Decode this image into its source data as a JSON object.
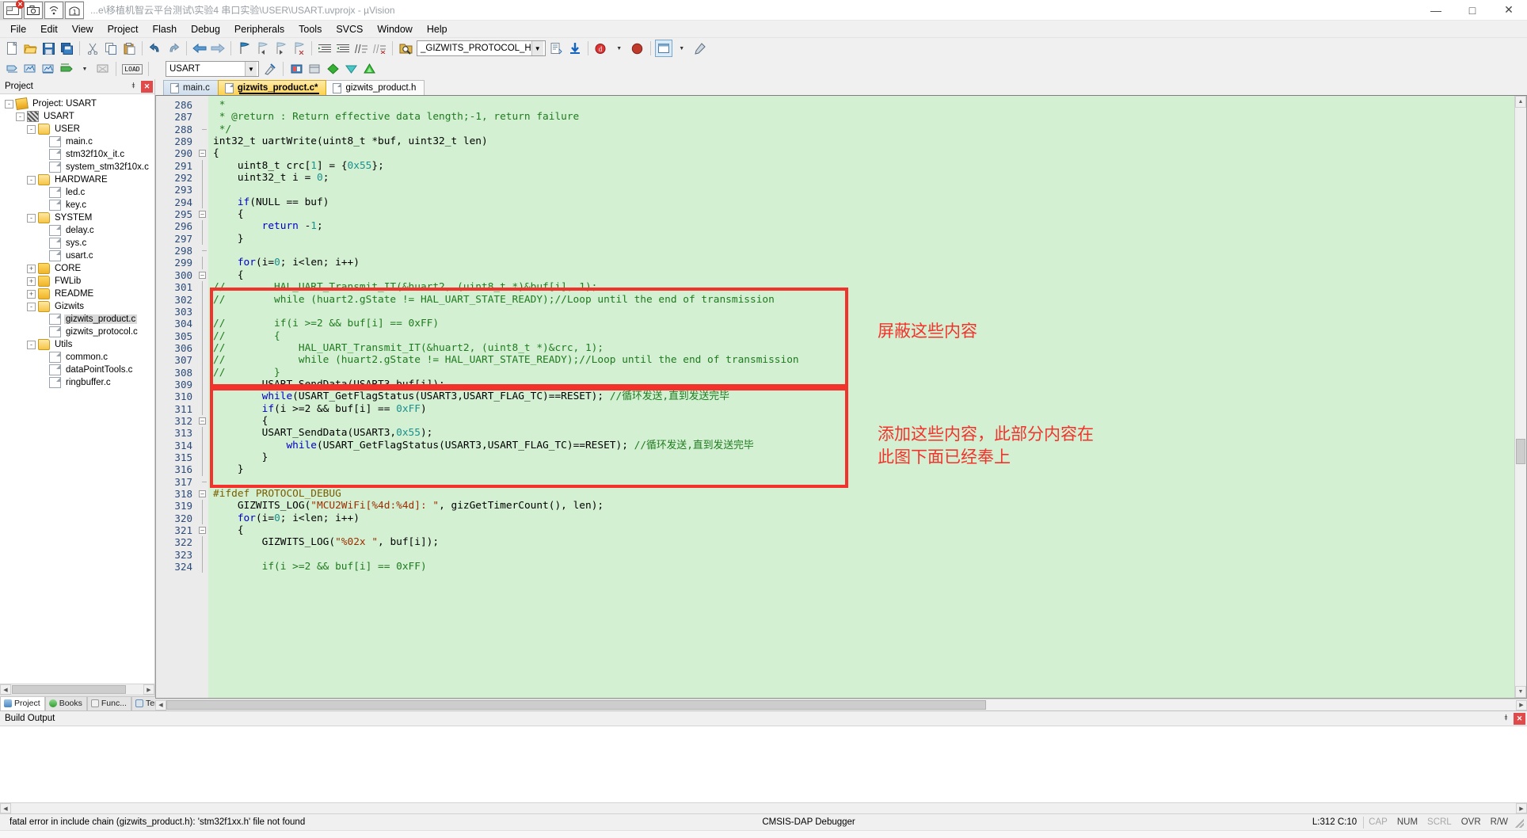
{
  "window": {
    "title": "...e\\移植机智云平台测试\\实验4 串口实验\\USER\\USART.uvprojx - µVision",
    "minimize": "—",
    "maximize": "□",
    "close": "✕"
  },
  "menubar": [
    "File",
    "Edit",
    "View",
    "Project",
    "Flash",
    "Debug",
    "Peripherals",
    "Tools",
    "SVCS",
    "Window",
    "Help"
  ],
  "toolbar1": {
    "buttons": [
      "new-file",
      "open-file",
      "save",
      "save-all",
      "cut",
      "copy",
      "paste",
      "undo",
      "redo",
      "navigate-back",
      "navigate-forward",
      "bookmark-toggle",
      "bookmark-prev",
      "bookmark-next",
      "bookmark-clear",
      "indent",
      "outdent",
      "comment",
      "uncomment",
      "find-in-files"
    ],
    "combo_value": "_GIZWITS_PROTOCOL_H",
    "extra": [
      "insert-file",
      "download",
      "debug-start",
      "debug-dropdown",
      "target-options"
    ]
  },
  "toolbar2": {
    "combo_value": "USART",
    "load_label": "LOAD",
    "buttons": [
      "translate",
      "build",
      "rebuild",
      "batch-build",
      "stop-build",
      "load-flash",
      "target-options-2",
      "manage-run-env",
      "new-item",
      "packs",
      "pack-installer"
    ]
  },
  "project_pane": {
    "title": "Project",
    "autohide_icon": "pin-icon",
    "close_icon": "close-icon",
    "tabs": [
      {
        "label": "Project",
        "icon": "project-icon",
        "active": true
      },
      {
        "label": "Books",
        "icon": "books-icon",
        "active": false
      },
      {
        "label": "Func...",
        "icon": "functions-icon",
        "active": false
      },
      {
        "label": "Temp...",
        "icon": "templates-icon",
        "active": false
      }
    ],
    "tree": [
      {
        "label": "Project: USART",
        "depth": 0,
        "icon": "project",
        "expander": "-"
      },
      {
        "label": "USART",
        "depth": 1,
        "icon": "target",
        "expander": "-"
      },
      {
        "label": "USER",
        "depth": 2,
        "icon": "folder-open",
        "expander": "-"
      },
      {
        "label": "main.c",
        "depth": 3,
        "icon": "file",
        "expander": ""
      },
      {
        "label": "stm32f10x_it.c",
        "depth": 3,
        "icon": "file",
        "expander": ""
      },
      {
        "label": "system_stm32f10x.c",
        "depth": 3,
        "icon": "file",
        "expander": ""
      },
      {
        "label": "HARDWARE",
        "depth": 2,
        "icon": "folder-open",
        "expander": "-"
      },
      {
        "label": "led.c",
        "depth": 3,
        "icon": "file",
        "expander": ""
      },
      {
        "label": "key.c",
        "depth": 3,
        "icon": "file",
        "expander": ""
      },
      {
        "label": "SYSTEM",
        "depth": 2,
        "icon": "folder-open",
        "expander": "-"
      },
      {
        "label": "delay.c",
        "depth": 3,
        "icon": "file",
        "expander": ""
      },
      {
        "label": "sys.c",
        "depth": 3,
        "icon": "file",
        "expander": ""
      },
      {
        "label": "usart.c",
        "depth": 3,
        "icon": "file",
        "expander": ""
      },
      {
        "label": "CORE",
        "depth": 2,
        "icon": "folder",
        "expander": "+"
      },
      {
        "label": "FWLib",
        "depth": 2,
        "icon": "folder",
        "expander": "+"
      },
      {
        "label": "README",
        "depth": 2,
        "icon": "folder",
        "expander": "+"
      },
      {
        "label": "Gizwits",
        "depth": 2,
        "icon": "folder-open",
        "expander": "-"
      },
      {
        "label": "gizwits_product.c",
        "depth": 3,
        "icon": "file",
        "expander": "",
        "selected": true
      },
      {
        "label": "gizwits_protocol.c",
        "depth": 3,
        "icon": "file",
        "expander": ""
      },
      {
        "label": "Utils",
        "depth": 2,
        "icon": "folder-open",
        "expander": "-"
      },
      {
        "label": "common.c",
        "depth": 3,
        "icon": "file",
        "expander": ""
      },
      {
        "label": "dataPointTools.c",
        "depth": 3,
        "icon": "file",
        "expander": ""
      },
      {
        "label": "ringbuffer.c",
        "depth": 3,
        "icon": "file",
        "expander": ""
      }
    ]
  },
  "editor": {
    "tabs": [
      {
        "label": "main.c",
        "state": "inactive"
      },
      {
        "label": "gizwits_product.c*",
        "state": "active"
      },
      {
        "label": "gizwits_product.h",
        "state": "plain"
      }
    ],
    "first_line_number": 286,
    "lines": [
      {
        "n": 286,
        "fold": "",
        "tokens": [
          {
            "t": " *",
            "c": "cm"
          }
        ]
      },
      {
        "n": 287,
        "fold": "",
        "tokens": [
          {
            "t": " * @return : Return effective data length;-1, return failure",
            "c": "cm"
          }
        ]
      },
      {
        "n": 288,
        "fold": "end",
        "tokens": [
          {
            "t": " */",
            "c": "cm"
          }
        ]
      },
      {
        "n": 289,
        "fold": "",
        "tokens": [
          {
            "t": "int32_t uartWrite(uint8_t *buf, uint32_t len)",
            "c": ""
          }
        ]
      },
      {
        "n": 290,
        "fold": "box",
        "tokens": [
          {
            "t": "{",
            "c": ""
          }
        ]
      },
      {
        "n": 291,
        "fold": "bar",
        "tokens": [
          {
            "t": "    uint8_t crc[",
            "c": ""
          },
          {
            "t": "1",
            "c": "num"
          },
          {
            "t": "] = {",
            "c": ""
          },
          {
            "t": "0x55",
            "c": "num"
          },
          {
            "t": "};",
            "c": ""
          }
        ]
      },
      {
        "n": 292,
        "fold": "bar",
        "tokens": [
          {
            "t": "    uint32_t i = ",
            "c": ""
          },
          {
            "t": "0",
            "c": "num"
          },
          {
            "t": ";",
            "c": ""
          }
        ]
      },
      {
        "n": 293,
        "fold": "bar",
        "tokens": [
          {
            "t": "",
            "c": ""
          }
        ]
      },
      {
        "n": 294,
        "fold": "bar",
        "tokens": [
          {
            "t": "    ",
            "c": ""
          },
          {
            "t": "if",
            "c": "k"
          },
          {
            "t": "(NULL == buf)",
            "c": ""
          }
        ]
      },
      {
        "n": 295,
        "fold": "box",
        "tokens": [
          {
            "t": "    {",
            "c": ""
          }
        ]
      },
      {
        "n": 296,
        "fold": "bar",
        "tokens": [
          {
            "t": "        ",
            "c": ""
          },
          {
            "t": "return",
            "c": "k"
          },
          {
            "t": " -",
            "c": ""
          },
          {
            "t": "1",
            "c": "num"
          },
          {
            "t": ";",
            "c": ""
          }
        ]
      },
      {
        "n": 297,
        "fold": "bar",
        "tokens": [
          {
            "t": "    }",
            "c": ""
          }
        ]
      },
      {
        "n": 298,
        "fold": "dash",
        "tokens": [
          {
            "t": "",
            "c": ""
          }
        ]
      },
      {
        "n": 299,
        "fold": "bar",
        "tokens": [
          {
            "t": "    ",
            "c": ""
          },
          {
            "t": "for",
            "c": "k"
          },
          {
            "t": "(i=",
            "c": ""
          },
          {
            "t": "0",
            "c": "num"
          },
          {
            "t": "; i<len; i++)",
            "c": ""
          }
        ]
      },
      {
        "n": 300,
        "fold": "box",
        "tokens": [
          {
            "t": "    {",
            "c": ""
          }
        ]
      },
      {
        "n": 301,
        "fold": "bar",
        "tokens": [
          {
            "t": "//        HAL_UART_Transmit_IT(&huart2, (uint8_t *)&buf[i], 1);",
            "c": "cm"
          }
        ]
      },
      {
        "n": 302,
        "fold": "bar",
        "tokens": [
          {
            "t": "//        while (huart2.gState != HAL_UART_STATE_READY);//Loop until the end of transmission",
            "c": "cm"
          }
        ]
      },
      {
        "n": 303,
        "fold": "bar",
        "tokens": [
          {
            "t": "",
            "c": ""
          }
        ]
      },
      {
        "n": 304,
        "fold": "bar",
        "tokens": [
          {
            "t": "//        if(i >=2 && buf[i] == 0xFF)",
            "c": "cm"
          }
        ]
      },
      {
        "n": 305,
        "fold": "bar",
        "tokens": [
          {
            "t": "//        {",
            "c": "cm"
          }
        ]
      },
      {
        "n": 306,
        "fold": "bar",
        "tokens": [
          {
            "t": "//            HAL_UART_Transmit_IT(&huart2, (uint8_t *)&crc, 1);",
            "c": "cm"
          }
        ]
      },
      {
        "n": 307,
        "fold": "bar",
        "tokens": [
          {
            "t": "//            while (huart2.gState != HAL_UART_STATE_READY);//Loop until the end of transmission",
            "c": "cm"
          }
        ]
      },
      {
        "n": 308,
        "fold": "bar",
        "tokens": [
          {
            "t": "//        }",
            "c": "cm"
          }
        ]
      },
      {
        "n": 309,
        "fold": "bar",
        "tokens": [
          {
            "t": "        USART_SendData(USART3,buf[i]);",
            "c": ""
          }
        ]
      },
      {
        "n": 310,
        "fold": "bar",
        "tokens": [
          {
            "t": "        ",
            "c": ""
          },
          {
            "t": "while",
            "c": "k"
          },
          {
            "t": "(USART_GetFlagStatus(USART3,USART_FLAG_TC)==RESET); ",
            "c": ""
          },
          {
            "t": "//循环发送,直到发送完毕",
            "c": "cm"
          }
        ]
      },
      {
        "n": 311,
        "fold": "bar",
        "tokens": [
          {
            "t": "        ",
            "c": ""
          },
          {
            "t": "if",
            "c": "k"
          },
          {
            "t": "(i >=2 && buf[i] == ",
            "c": ""
          },
          {
            "t": "0xFF",
            "c": "num"
          },
          {
            "t": ")",
            "c": ""
          }
        ]
      },
      {
        "n": 312,
        "fold": "box",
        "tokens": [
          {
            "t": "        {",
            "c": ""
          }
        ]
      },
      {
        "n": 313,
        "fold": "bar",
        "tokens": [
          {
            "t": "        USART_SendData(USART3,",
            "c": ""
          },
          {
            "t": "0x55",
            "c": "num"
          },
          {
            "t": ");",
            "c": ""
          }
        ]
      },
      {
        "n": 314,
        "fold": "bar",
        "tokens": [
          {
            "t": "            ",
            "c": ""
          },
          {
            "t": "while",
            "c": "k"
          },
          {
            "t": "(USART_GetFlagStatus(USART3,USART_FLAG_TC)==RESET); ",
            "c": ""
          },
          {
            "t": "//循环发送,直到发送完毕",
            "c": "cm"
          }
        ]
      },
      {
        "n": 315,
        "fold": "bar",
        "tokens": [
          {
            "t": "        }",
            "c": ""
          }
        ]
      },
      {
        "n": 316,
        "fold": "bar",
        "tokens": [
          {
            "t": "    }",
            "c": ""
          }
        ]
      },
      {
        "n": 317,
        "fold": "dash",
        "tokens": [
          {
            "t": "",
            "c": ""
          }
        ]
      },
      {
        "n": 318,
        "fold": "box",
        "tokens": [
          {
            "t": "#ifdef PROTOCOL_DEBUG",
            "c": "pp"
          }
        ]
      },
      {
        "n": 319,
        "fold": "bar",
        "tokens": [
          {
            "t": "    GIZWITS_LOG(",
            "c": ""
          },
          {
            "t": "\"MCU2WiFi[%4d:%4d]: \"",
            "c": "str"
          },
          {
            "t": ", gizGetTimerCount(), len);",
            "c": ""
          }
        ]
      },
      {
        "n": 320,
        "fold": "bar",
        "tokens": [
          {
            "t": "    ",
            "c": ""
          },
          {
            "t": "for",
            "c": "k"
          },
          {
            "t": "(i=",
            "c": ""
          },
          {
            "t": "0",
            "c": "num"
          },
          {
            "t": "; i<len; i++)",
            "c": ""
          }
        ]
      },
      {
        "n": 321,
        "fold": "box",
        "tokens": [
          {
            "t": "    {",
            "c": ""
          }
        ]
      },
      {
        "n": 322,
        "fold": "bar",
        "tokens": [
          {
            "t": "        GIZWITS_LOG(",
            "c": ""
          },
          {
            "t": "\"%02x \"",
            "c": "str"
          },
          {
            "t": ", buf[i]);",
            "c": ""
          }
        ]
      },
      {
        "n": 323,
        "fold": "bar",
        "tokens": [
          {
            "t": "",
            "c": ""
          }
        ]
      },
      {
        "n": 324,
        "fold": "bar",
        "tokens": [
          {
            "t": "        if(i >=2 && buf[i] == 0xFF)",
            "c": "cm"
          }
        ]
      }
    ],
    "annotations": [
      {
        "name": "note-block-content",
        "text": "屏蔽这些内容"
      },
      {
        "name": "note-add-content",
        "text": "添加这些内容，此部分内容在\n此图下面已经奉上"
      }
    ],
    "accent_red": "#f4322c"
  },
  "build_output": {
    "title": "Build Output"
  },
  "statusbar": {
    "message": "fatal error in include chain (gizwits_product.h): 'stm32f1xx.h' file not found",
    "debugger": "CMSIS-DAP Debugger",
    "position": "L:312 C:10",
    "keys": [
      "CAP",
      "NUM",
      "SCRL",
      "OVR",
      "R/W"
    ]
  }
}
